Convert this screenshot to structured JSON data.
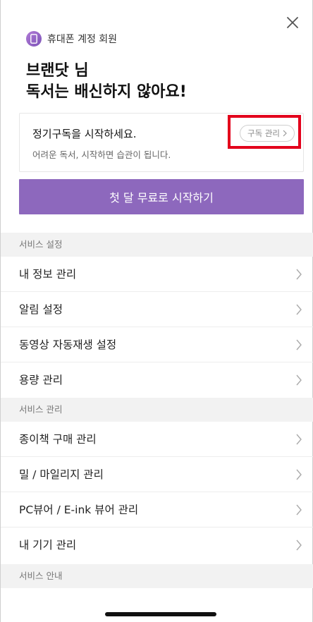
{
  "header": {
    "account_label": "휴대폰 계정 회원",
    "greeting_line1": "브랜닷 님",
    "greeting_line2": "독서는 배신하지 않아요!"
  },
  "promo": {
    "title": "정기구독을 시작하세요.",
    "subtitle": "어려운 독서, 시작하면 습관이 됩니다.",
    "manage_button": "구독 관리",
    "cta": "첫 달 무료로 시작하기"
  },
  "sections": {
    "service_settings": "서비스 설정",
    "service_management": "서비스 관리",
    "service_info": "서비스 안내"
  },
  "settings_items": [
    "내 정보 관리",
    "알림 설정",
    "동영상 자동재생 설정",
    "용량 관리"
  ],
  "management_items": [
    "종이책 구매 관리",
    "밀 / 마일리지 관리",
    "PC뷰어 / E-ink 뷰어 관리",
    "내 기기 관리"
  ],
  "colors": {
    "cta": "#8d68bd",
    "highlight": "#e3001b",
    "section_bg": "#f2f2f2"
  }
}
